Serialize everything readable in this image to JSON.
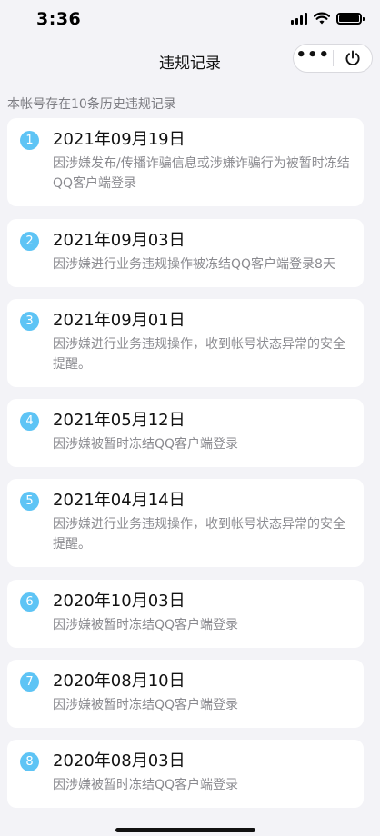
{
  "status_bar": {
    "time": "3:36"
  },
  "nav": {
    "title": "违规记录",
    "more_icon": "more-dots-icon",
    "power_icon": "power-icon"
  },
  "summary": "本帐号存在10条历史违规记录",
  "records": [
    {
      "index": "1",
      "date": "2021年09月19日",
      "desc": "因涉嫌发布/传播诈骗信息或涉嫌诈骗行为被暂时冻结QQ客户端登录"
    },
    {
      "index": "2",
      "date": "2021年09月03日",
      "desc": "因涉嫌进行业务违规操作被冻结QQ客户端登录8天"
    },
    {
      "index": "3",
      "date": "2021年09月01日",
      "desc": "因涉嫌进行业务违规操作，收到帐号状态异常的安全提醒。"
    },
    {
      "index": "4",
      "date": "2021年05月12日",
      "desc": "因涉嫌被暂时冻结QQ客户端登录"
    },
    {
      "index": "5",
      "date": "2021年04月14日",
      "desc": "因涉嫌进行业务违规操作，收到帐号状态异常的安全提醒。"
    },
    {
      "index": "6",
      "date": "2020年10月03日",
      "desc": "因涉嫌被暂时冻结QQ客户端登录"
    },
    {
      "index": "7",
      "date": "2020年08月10日",
      "desc": "因涉嫌被暂时冻结QQ客户端登录"
    },
    {
      "index": "8",
      "date": "2020年08月03日",
      "desc": "因涉嫌被暂时冻结QQ客户端登录"
    }
  ],
  "colors": {
    "badge": "#5ec4f5",
    "background": "#f3f3f7",
    "card": "#ffffff",
    "muted_text": "#8a8a8f"
  }
}
